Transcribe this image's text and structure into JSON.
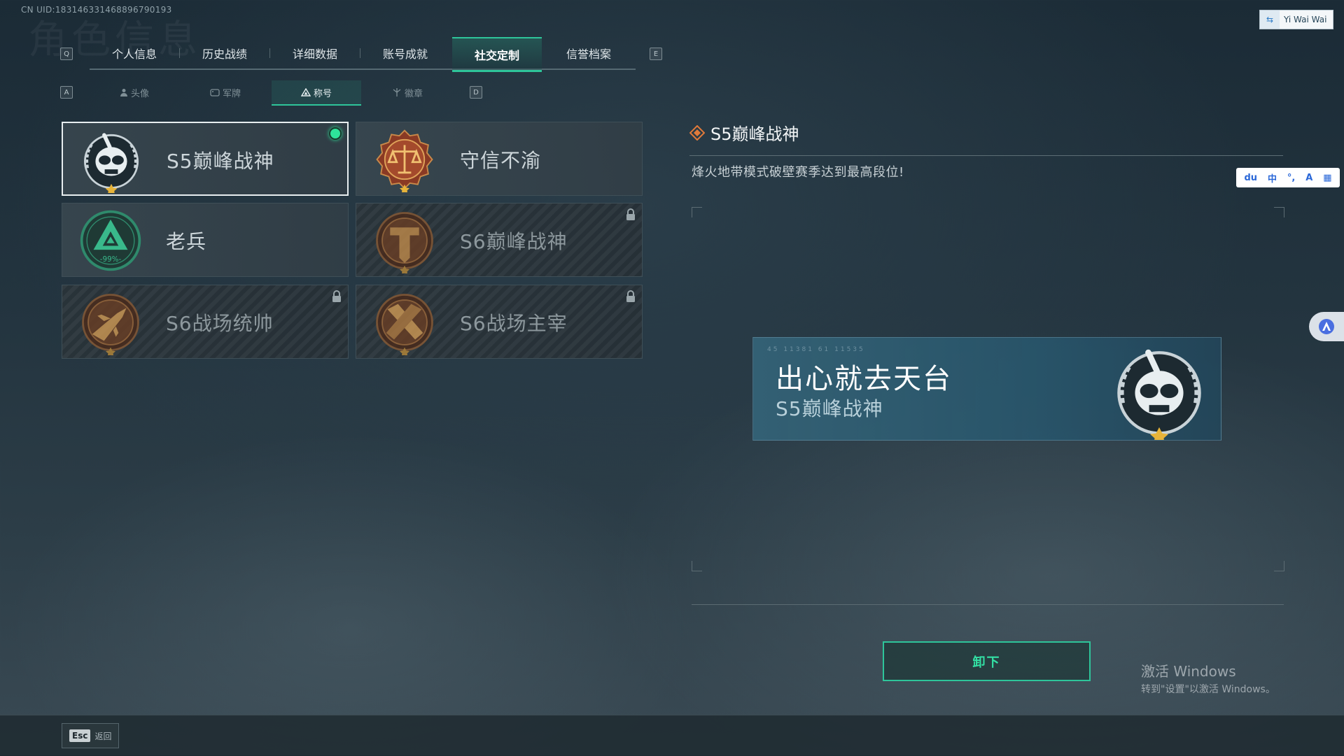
{
  "uid_text": "CN UID:183146331468896790193",
  "page_watermark_title": "角色信息",
  "tabs": {
    "left_key": "Q",
    "right_key": "E",
    "items": [
      {
        "label": "个人信息"
      },
      {
        "label": "历史战绩"
      },
      {
        "label": "详细数据"
      },
      {
        "label": "账号成就"
      },
      {
        "label": "社交定制"
      },
      {
        "label": "信誉档案"
      }
    ],
    "active_index": 4
  },
  "subtabs": {
    "left_key": "A",
    "right_key": "D",
    "items": [
      {
        "label": "头像",
        "icon": "person-icon"
      },
      {
        "label": "军牌",
        "icon": "dogtag-icon"
      },
      {
        "label": "称号",
        "icon": "triangle-icon"
      },
      {
        "label": "徽章",
        "icon": "badge-icon"
      }
    ],
    "active_index": 2
  },
  "titles": [
    {
      "name": "S5巅峰战神",
      "emblem": "skull-emblem-icon",
      "selected": true,
      "equipped": true,
      "locked": false
    },
    {
      "name": "守信不渝",
      "emblem": "scales-emblem-icon",
      "selected": false,
      "equipped": false,
      "locked": false
    },
    {
      "name": "老兵",
      "emblem": "veteran-emblem-icon",
      "emblem_text": "-99%-",
      "selected": false,
      "equipped": false,
      "locked": false
    },
    {
      "name": "S6巅峰战神",
      "emblem": "t-emblem-icon",
      "selected": false,
      "equipped": false,
      "locked": true
    },
    {
      "name": "S6战场统帅",
      "emblem": "jet-emblem-icon",
      "selected": false,
      "equipped": false,
      "locked": true
    },
    {
      "name": "S6战场主宰",
      "emblem": "crossed-emblem-icon",
      "selected": false,
      "equipped": false,
      "locked": true
    }
  ],
  "detail": {
    "title": "S5巅峰战神",
    "description": "烽火地带模式破壁赛季达到最高段位!"
  },
  "namecard": {
    "player_name": "出心就去天台",
    "title": "S5巅峰战神",
    "tiny_text": "45  11381  61  11535"
  },
  "unequip_label": "卸下",
  "back": {
    "key": "Esc",
    "label": "返回"
  },
  "windows_activation": {
    "line1": "激活 Windows",
    "line2": "转到\"设置\"以激活 Windows。"
  },
  "user_badge": "Yi Wai Wai",
  "ime_bar": [
    "du",
    "中",
    "°,",
    "A",
    "▦"
  ],
  "colors": {
    "accent": "#2ec59a",
    "equipped_dot": "#2ee39a"
  }
}
